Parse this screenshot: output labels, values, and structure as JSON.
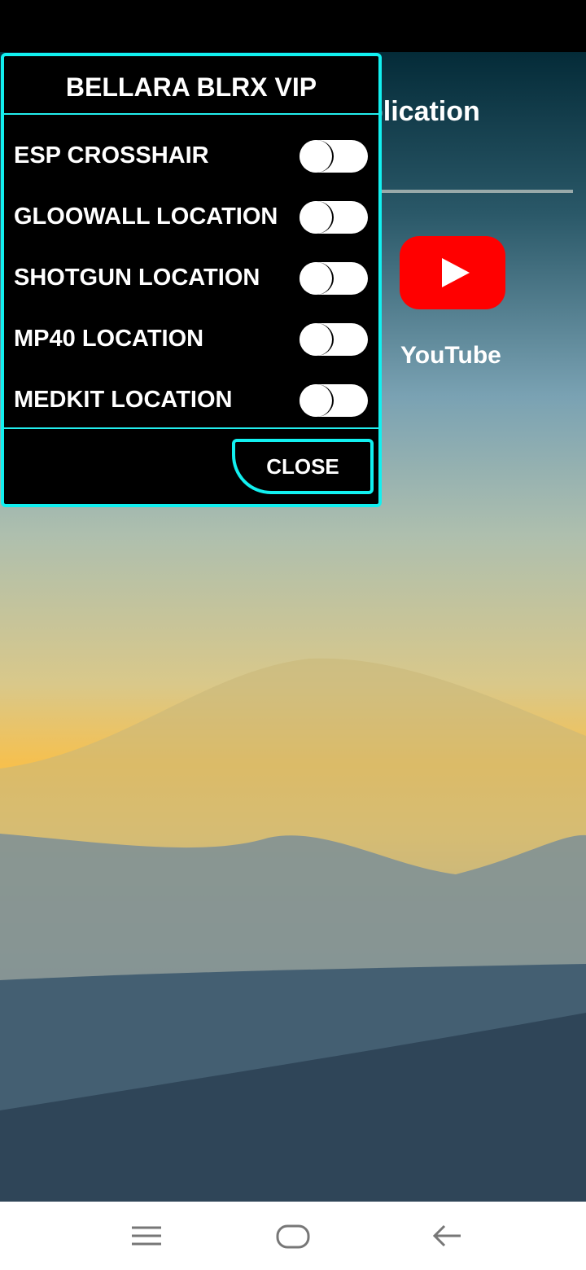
{
  "background_app": {
    "title_fragment": "plication",
    "icons": [
      {
        "name": "youtube-icon",
        "label": "YouTube",
        "color": "#ff0000"
      }
    ]
  },
  "menu": {
    "title": "BELLARA BLRX VIP",
    "accent_color": "#12f0f0",
    "items": [
      {
        "label": "ESP CROSSHAIR",
        "on": false
      },
      {
        "label": "GLOOWALL LOCATION",
        "on": false
      },
      {
        "label": "SHOTGUN LOCATION",
        "on": false
      },
      {
        "label": "MP40 LOCATION",
        "on": false
      },
      {
        "label": "MEDKIT LOCATION",
        "on": false
      }
    ],
    "close_label": "CLOSE"
  },
  "navbar": {
    "buttons": [
      "menu-icon",
      "home-icon",
      "back-icon"
    ]
  }
}
